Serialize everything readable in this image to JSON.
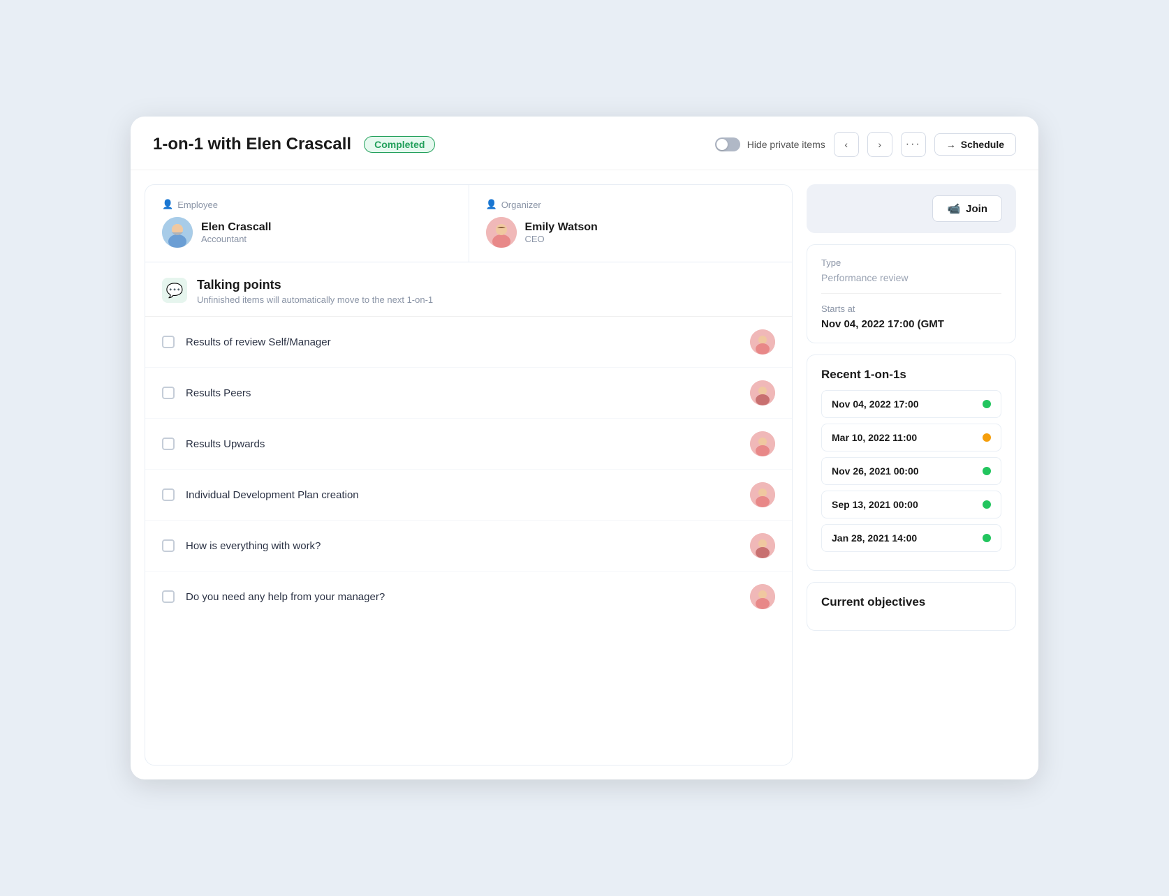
{
  "header": {
    "title": "1-on-1 with Elen Crascall",
    "status": "Completed",
    "hide_private_label": "Hide private items",
    "schedule_label": "Schedule",
    "nav_prev": "<",
    "nav_next": ">",
    "more_icon": "···"
  },
  "employee": {
    "role": "Employee",
    "name": "Elen Crascall",
    "title": "Accountant",
    "avatar_initials": "👤"
  },
  "organizer": {
    "role": "Organizer",
    "name": "Emily Watson",
    "title": "CEO",
    "avatar_initials": "👤"
  },
  "talking_points": {
    "title": "Talking points",
    "subtitle": "Unfinished items will automatically move to the next 1-on-1"
  },
  "agenda_items": [
    {
      "text": "Results of review Self/Manager"
    },
    {
      "text": "Results Peers"
    },
    {
      "text": "Results Upwards"
    },
    {
      "text": "Individual Development Plan creation"
    },
    {
      "text": "How is everything with work?"
    },
    {
      "text": "Do you need any help from your manager?"
    }
  ],
  "sidebar": {
    "join_label": "Join",
    "type_label": "Type",
    "type_value": "Performance review",
    "starts_label": "Starts at",
    "starts_value": "Nov 04, 2022 17:00 (GMT",
    "recent_title": "Recent 1-on-1s",
    "recent_items": [
      {
        "date": "Nov 04, 2022 17:00",
        "status": "green"
      },
      {
        "date": "Mar 10, 2022 11:00",
        "status": "yellow"
      },
      {
        "date": "Nov 26, 2021 00:00",
        "status": "green"
      },
      {
        "date": "Sep 13, 2021 00:00",
        "status": "green"
      },
      {
        "date": "Jan 28, 2021 14:00",
        "status": "green"
      }
    ],
    "current_objectives_title": "Current objectives"
  }
}
